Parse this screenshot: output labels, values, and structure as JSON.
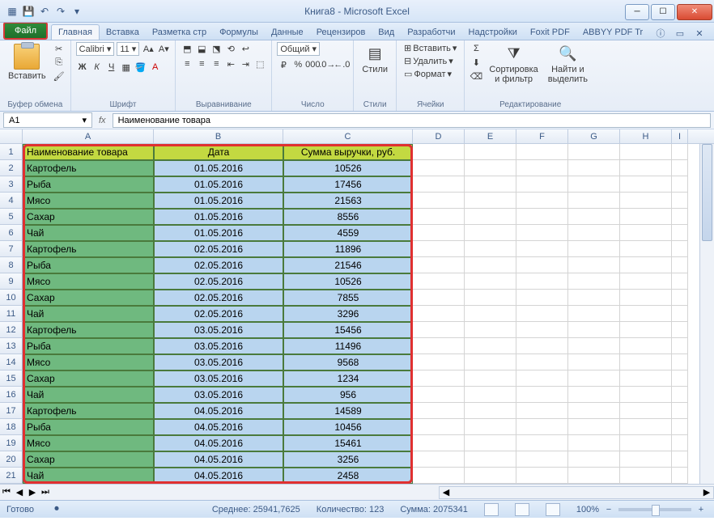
{
  "window": {
    "title": "Книга8 - Microsoft Excel"
  },
  "tabs": {
    "file": "Файл",
    "items": [
      "Главная",
      "Вставка",
      "Разметка стр",
      "Формулы",
      "Данные",
      "Рецензиров",
      "Вид",
      "Разработчи",
      "Надстройки",
      "Foxit PDF",
      "ABBYY PDF Tr"
    ],
    "active": 0
  },
  "ribbon": {
    "clipboard": {
      "paste": "Вставить",
      "label": "Буфер обмена"
    },
    "font": {
      "name": "Calibri",
      "size": "11",
      "label": "Шрифт"
    },
    "align": {
      "label": "Выравнивание"
    },
    "number": {
      "format": "Общий",
      "label": "Число"
    },
    "styles": {
      "styles": "Стили",
      "label": "Стили"
    },
    "cells": {
      "insert": "Вставить",
      "delete": "Удалить",
      "format": "Формат",
      "label": "Ячейки"
    },
    "editing": {
      "sort": "Сортировка\nи фильтр",
      "find": "Найти и\nвыделить",
      "label": "Редактирование"
    }
  },
  "namebox": "A1",
  "formula": "Наименование товара",
  "columns": [
    "A",
    "B",
    "C",
    "D",
    "E",
    "F",
    "G",
    "H",
    "I"
  ],
  "headers": [
    "Наименование товара",
    "Дата",
    "Сумма выручки, руб."
  ],
  "rows": [
    [
      "Картофель",
      "01.05.2016",
      "10526"
    ],
    [
      "Рыба",
      "01.05.2016",
      "17456"
    ],
    [
      "Мясо",
      "01.05.2016",
      "21563"
    ],
    [
      "Сахар",
      "01.05.2016",
      "8556"
    ],
    [
      "Чай",
      "01.05.2016",
      "4559"
    ],
    [
      "Картофель",
      "02.05.2016",
      "11896"
    ],
    [
      "Рыба",
      "02.05.2016",
      "21546"
    ],
    [
      "Мясо",
      "02.05.2016",
      "10526"
    ],
    [
      "Сахар",
      "02.05.2016",
      "7855"
    ],
    [
      "Чай",
      "02.05.2016",
      "3296"
    ],
    [
      "Картофель",
      "03.05.2016",
      "15456"
    ],
    [
      "Рыба",
      "03.05.2016",
      "11496"
    ],
    [
      "Мясо",
      "03.05.2016",
      "9568"
    ],
    [
      "Сахар",
      "03.05.2016",
      "1234"
    ],
    [
      "Чай",
      "03.05.2016",
      "956"
    ],
    [
      "Картофель",
      "04.05.2016",
      "14589"
    ],
    [
      "Рыба",
      "04.05.2016",
      "10456"
    ],
    [
      "Мясо",
      "04.05.2016",
      "15461"
    ],
    [
      "Сахар",
      "04.05.2016",
      "3256"
    ],
    [
      "Чай",
      "04.05.2016",
      "2458"
    ]
  ],
  "status": {
    "ready": "Готово",
    "avg_label": "Среднее:",
    "avg": "25941,7625",
    "count_label": "Количество:",
    "count": "123",
    "sum_label": "Сумма:",
    "sum": "2075341",
    "zoom": "100%"
  }
}
